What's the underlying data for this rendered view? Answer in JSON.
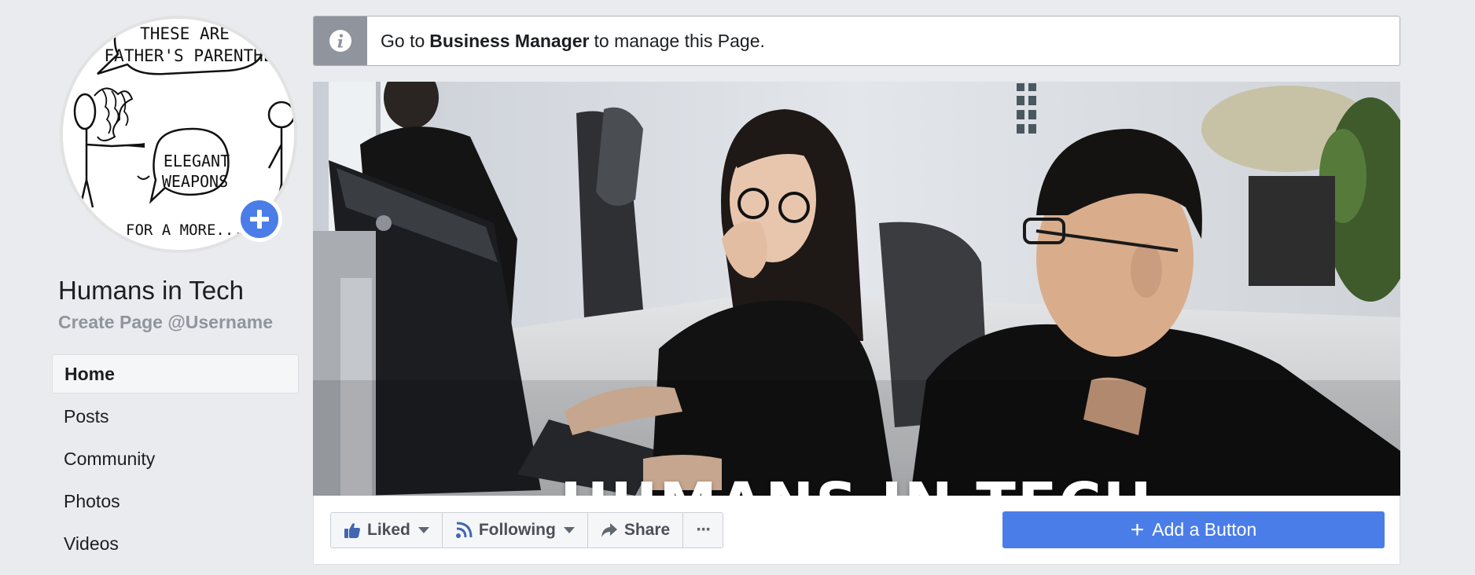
{
  "profile": {
    "comic_text": [
      "THESE ARE",
      "FATHER'S PARENTHE",
      "ELEGANT",
      "WEAPONS",
      "FOR A MORE... C"
    ],
    "add_icon": "plus-icon"
  },
  "page": {
    "name": "Humans in Tech",
    "username_link": "Create Page @Username"
  },
  "nav": {
    "items": [
      {
        "label": "Home",
        "active": true
      },
      {
        "label": "Posts",
        "active": false
      },
      {
        "label": "Community",
        "active": false
      },
      {
        "label": "Photos",
        "active": false
      },
      {
        "label": "Videos",
        "active": false
      }
    ]
  },
  "notice": {
    "icon": "info-icon",
    "prefix": "Go to",
    "link": "Business Manager",
    "suffix": "to manage this Page."
  },
  "cover": {
    "title": "HUMANS IN TECH"
  },
  "actions": {
    "liked": {
      "label": "Liked",
      "icon": "thumbs-up-icon"
    },
    "following": {
      "label": "Following",
      "icon": "rss-icon"
    },
    "share": {
      "label": "Share",
      "icon": "share-arrow-icon"
    },
    "more": {
      "label": "···",
      "icon": "more-icon"
    },
    "add_button": {
      "label": "Add a Button",
      "plus": "+"
    }
  },
  "colors": {
    "background": "#e9ebee",
    "accent": "#4a7de8",
    "muted": "#90949c",
    "like_blue": "#4267b2"
  }
}
